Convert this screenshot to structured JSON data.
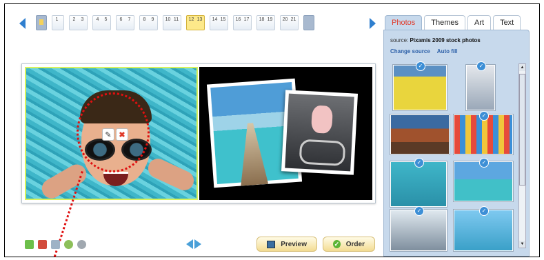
{
  "page_strip": {
    "prev_label": "",
    "next_label": "",
    "spreads": [
      {
        "id": "cover",
        "pages": []
      },
      {
        "id": "1",
        "pages": [
          "1"
        ]
      },
      {
        "id": "2-3",
        "pages": [
          "2",
          "3"
        ]
      },
      {
        "id": "4-5",
        "pages": [
          "4",
          "5"
        ]
      },
      {
        "id": "6-7",
        "pages": [
          "6",
          "7"
        ]
      },
      {
        "id": "8-9",
        "pages": [
          "8",
          "9"
        ]
      },
      {
        "id": "10-11",
        "pages": [
          "10",
          "11"
        ]
      },
      {
        "id": "12-13",
        "pages": [
          "12",
          "13"
        ],
        "active": true
      },
      {
        "id": "14-15",
        "pages": [
          "14",
          "15"
        ]
      },
      {
        "id": "16-17",
        "pages": [
          "16",
          "17"
        ]
      },
      {
        "id": "18-19",
        "pages": [
          "18",
          "19"
        ]
      },
      {
        "id": "20-21",
        "pages": [
          "20",
          "21"
        ]
      },
      {
        "id": "back",
        "pages": []
      }
    ]
  },
  "photo_controls": {
    "edit": "✎",
    "delete": "✖"
  },
  "toolbar": {
    "preview_label": "Preview",
    "order_label": "Order"
  },
  "panel": {
    "tabs": [
      {
        "label": "Photos",
        "active": true
      },
      {
        "label": "Themes"
      },
      {
        "label": "Art"
      },
      {
        "label": "Text"
      }
    ],
    "source_prefix": "source:",
    "source_name": "Pixamis 2009 stock photos",
    "change_source": "Change source",
    "auto_fill": "Auto fill",
    "check": "✓"
  },
  "colors": {
    "accent": "#2f7fcf",
    "active_tab_text": "#e03a2a",
    "annotation": "#e01010",
    "panel_bg": "#c7d9ec"
  }
}
